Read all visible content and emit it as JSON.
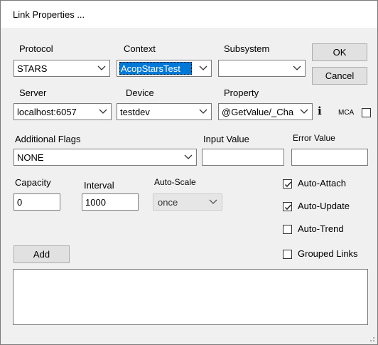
{
  "window": {
    "title": "Link Properties ..."
  },
  "labels": {
    "protocol": "Protocol",
    "context": "Context",
    "subsystem": "Subsystem",
    "server": "Server",
    "device": "Device",
    "property": "Property",
    "mca": "MCA",
    "additional_flags": "Additional Flags",
    "input_value": "Input Value",
    "error_value": "Error Value",
    "capacity": "Capacity",
    "interval": "Interval",
    "auto_scale": "Auto-Scale"
  },
  "fields": {
    "protocol": "STARS",
    "context": "AcopStarsTest",
    "subsystem": "",
    "server": "localhost:6057",
    "device": "testdev",
    "property": "@GetValue/_Cha",
    "additional_flags": "NONE",
    "input_value": "",
    "error_value": "",
    "capacity": "0",
    "interval": "1000",
    "auto_scale": "once"
  },
  "info_glyph": "i",
  "buttons": {
    "ok": "OK",
    "cancel": "Cancel",
    "add": "Add"
  },
  "checkboxes": {
    "mca": {
      "checked": false
    },
    "auto_attach": {
      "label": "Auto-Attach",
      "checked": true
    },
    "auto_update": {
      "label": "Auto-Update",
      "checked": true
    },
    "auto_trend": {
      "label": "Auto-Trend",
      "checked": false
    },
    "grouped_links": {
      "label": "Grouped Links",
      "checked": false
    }
  },
  "icons": {
    "dropdown": "chevron-down-icon",
    "check": "checkmark-icon",
    "grip": "resize-grip-icon"
  }
}
